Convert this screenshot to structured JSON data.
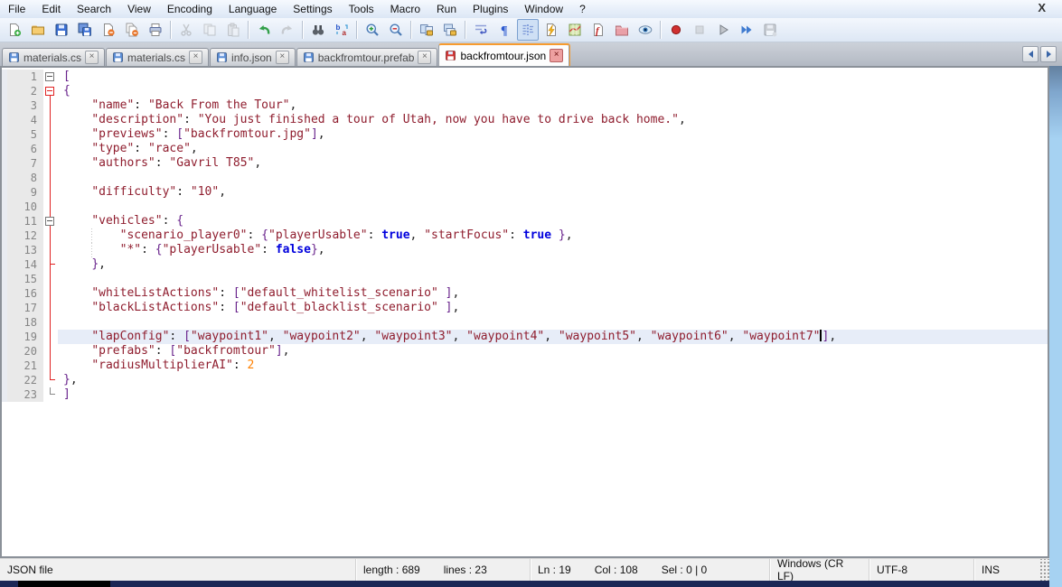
{
  "window": {
    "close_label": "X"
  },
  "palette": {
    "accent_tab_orange": "#f79b2e",
    "string_red": "#8f1d2e",
    "brace_purple": "#68228b",
    "bool_blue": "#0000dd",
    "number_orange": "#ff8000",
    "fold_active_red": "#e02222",
    "current_line_bg": "#e7edf8",
    "aero_border_blue": "#a6d2f2"
  },
  "menu": {
    "items": [
      "File",
      "Edit",
      "Search",
      "View",
      "Encoding",
      "Language",
      "Settings",
      "Tools",
      "Macro",
      "Run",
      "Plugins",
      "Window",
      "?"
    ]
  },
  "toolbar": {
    "items": [
      {
        "name": "new-file-icon"
      },
      {
        "name": "open-icon"
      },
      {
        "name": "save-icon"
      },
      {
        "name": "save-all-icon"
      },
      {
        "name": "close-icon"
      },
      {
        "name": "close-all-icon"
      },
      {
        "name": "print-icon"
      },
      {
        "sep": true
      },
      {
        "name": "cut-icon",
        "disabled": true
      },
      {
        "name": "copy-icon",
        "disabled": true
      },
      {
        "name": "paste-icon",
        "disabled": true
      },
      {
        "sep": true
      },
      {
        "name": "undo-icon"
      },
      {
        "name": "redo-icon",
        "disabled": true
      },
      {
        "sep": true
      },
      {
        "name": "find-icon"
      },
      {
        "name": "replace-icon"
      },
      {
        "sep": true
      },
      {
        "name": "zoom-in-icon"
      },
      {
        "name": "zoom-out-icon"
      },
      {
        "sep": true
      },
      {
        "name": "sync-vertical-icon"
      },
      {
        "name": "sync-horizontal-icon"
      },
      {
        "sep": true
      },
      {
        "name": "word-wrap-icon"
      },
      {
        "name": "show-all-characters-icon"
      },
      {
        "name": "show-indent-guide-icon",
        "pressed": true
      },
      {
        "name": "user-defined-dialog-icon"
      },
      {
        "name": "document-map-icon"
      },
      {
        "name": "function-list-icon"
      },
      {
        "name": "folder-as-workspace-icon"
      },
      {
        "name": "monitoring-icon"
      },
      {
        "sep": true
      },
      {
        "name": "record-macro-icon"
      },
      {
        "name": "stop-macro-icon",
        "disabled": true
      },
      {
        "name": "play-macro-icon"
      },
      {
        "name": "run-macro-multiple-icon"
      },
      {
        "name": "save-macro-icon",
        "disabled": true
      }
    ]
  },
  "tabs": {
    "items": [
      {
        "label": "materials.cs",
        "active": false,
        "modified": false
      },
      {
        "label": "materials.cs",
        "active": false,
        "modified": false
      },
      {
        "label": "info.json",
        "active": false,
        "modified": false
      },
      {
        "label": "backfromtour.prefab",
        "active": false,
        "modified": false
      },
      {
        "label": "backfromtour.json",
        "active": true,
        "modified": true
      }
    ]
  },
  "editor": {
    "current_line": 19,
    "lines": [
      {
        "n": 1,
        "fold": "box",
        "segs": [
          [
            "br",
            "["
          ]
        ]
      },
      {
        "n": 2,
        "fold": "boxr",
        "segs": [
          [
            "br",
            "{"
          ]
        ]
      },
      {
        "n": 3,
        "fold": "v",
        "segs": [
          [
            "d",
            "    "
          ],
          [
            "s",
            "\"name\""
          ],
          [
            "d",
            ": "
          ],
          [
            "s",
            "\"Back From the Tour\""
          ],
          [
            "d",
            ","
          ]
        ]
      },
      {
        "n": 4,
        "fold": "v",
        "segs": [
          [
            "d",
            "    "
          ],
          [
            "s",
            "\"description\""
          ],
          [
            "d",
            ": "
          ],
          [
            "s",
            "\"You just finished a tour of Utah, now you have to drive back home.\""
          ],
          [
            "d",
            ","
          ]
        ]
      },
      {
        "n": 5,
        "fold": "v",
        "segs": [
          [
            "d",
            "    "
          ],
          [
            "s",
            "\"previews\""
          ],
          [
            "d",
            ": "
          ],
          [
            "br",
            "["
          ],
          [
            "s",
            "\"backfromtour.jpg\""
          ],
          [
            "br",
            "]"
          ],
          [
            "d",
            ","
          ]
        ]
      },
      {
        "n": 6,
        "fold": "v",
        "segs": [
          [
            "d",
            "    "
          ],
          [
            "s",
            "\"type\""
          ],
          [
            "d",
            ": "
          ],
          [
            "s",
            "\"race\""
          ],
          [
            "d",
            ","
          ]
        ]
      },
      {
        "n": 7,
        "fold": "v",
        "segs": [
          [
            "d",
            "    "
          ],
          [
            "s",
            "\"authors\""
          ],
          [
            "d",
            ": "
          ],
          [
            "s",
            "\"Gavril T85\""
          ],
          [
            "d",
            ","
          ]
        ]
      },
      {
        "n": 8,
        "fold": "v",
        "segs": []
      },
      {
        "n": 9,
        "fold": "v",
        "segs": [
          [
            "d",
            "    "
          ],
          [
            "s",
            "\"difficulty\""
          ],
          [
            "d",
            ": "
          ],
          [
            "s",
            "\"10\""
          ],
          [
            "d",
            ","
          ]
        ]
      },
      {
        "n": 10,
        "fold": "v",
        "segs": []
      },
      {
        "n": 11,
        "fold": "vbox",
        "segs": [
          [
            "d",
            "    "
          ],
          [
            "s",
            "\"vehicles\""
          ],
          [
            "d",
            ": "
          ],
          [
            "br",
            "{"
          ]
        ]
      },
      {
        "n": 12,
        "fold": "v",
        "guide": true,
        "segs": [
          [
            "d",
            "        "
          ],
          [
            "s",
            "\"scenario_player0\""
          ],
          [
            "d",
            ": "
          ],
          [
            "br",
            "{"
          ],
          [
            "s",
            "\"playerUsable\""
          ],
          [
            "d",
            ": "
          ],
          [
            "b",
            "true"
          ],
          [
            "d",
            ", "
          ],
          [
            "s",
            "\"startFocus\""
          ],
          [
            "d",
            ": "
          ],
          [
            "b",
            "true"
          ],
          [
            "d",
            " "
          ],
          [
            "br",
            "}"
          ],
          [
            "d",
            ","
          ]
        ]
      },
      {
        "n": 13,
        "fold": "v",
        "guide": true,
        "segs": [
          [
            "d",
            "        "
          ],
          [
            "s",
            "\"*\""
          ],
          [
            "d",
            ": "
          ],
          [
            "br",
            "{"
          ],
          [
            "s",
            "\"playerUsable\""
          ],
          [
            "d",
            ": "
          ],
          [
            "b",
            "false"
          ],
          [
            "br",
            "}"
          ],
          [
            "d",
            ","
          ]
        ]
      },
      {
        "n": 14,
        "fold": "vtick",
        "segs": [
          [
            "d",
            "    "
          ],
          [
            "br",
            "}"
          ],
          [
            "d",
            ","
          ]
        ]
      },
      {
        "n": 15,
        "fold": "v",
        "segs": []
      },
      {
        "n": 16,
        "fold": "v",
        "segs": [
          [
            "d",
            "    "
          ],
          [
            "s",
            "\"whiteListActions\""
          ],
          [
            "d",
            ": "
          ],
          [
            "br",
            "["
          ],
          [
            "s",
            "\"default_whitelist_scenario\""
          ],
          [
            "d",
            " "
          ],
          [
            "br",
            "]"
          ],
          [
            "d",
            ","
          ]
        ]
      },
      {
        "n": 17,
        "fold": "v",
        "segs": [
          [
            "d",
            "    "
          ],
          [
            "s",
            "\"blackListActions\""
          ],
          [
            "d",
            ": "
          ],
          [
            "br",
            "["
          ],
          [
            "s",
            "\"default_blacklist_scenario\""
          ],
          [
            "d",
            " "
          ],
          [
            "br",
            "]"
          ],
          [
            "d",
            ","
          ]
        ]
      },
      {
        "n": 18,
        "fold": "v",
        "segs": []
      },
      {
        "n": 19,
        "fold": "v",
        "segs": [
          [
            "d",
            "    "
          ],
          [
            "s",
            "\"lapConfig\""
          ],
          [
            "d",
            ": "
          ],
          [
            "br",
            "["
          ],
          [
            "s",
            "\"waypoint1\""
          ],
          [
            "d",
            ", "
          ],
          [
            "s",
            "\"waypoint2\""
          ],
          [
            "d",
            ", "
          ],
          [
            "s",
            "\"waypoint3\""
          ],
          [
            "d",
            ", "
          ],
          [
            "s",
            "\"waypoint4\""
          ],
          [
            "d",
            ", "
          ],
          [
            "s",
            "\"waypoint5\""
          ],
          [
            "d",
            ", "
          ],
          [
            "s",
            "\"waypoint6\""
          ],
          [
            "d",
            ", "
          ],
          [
            "s",
            "\"waypoint7\""
          ],
          [
            "caret",
            ""
          ],
          [
            "br",
            "]"
          ],
          [
            "d",
            ","
          ]
        ]
      },
      {
        "n": 20,
        "fold": "v",
        "segs": [
          [
            "d",
            "    "
          ],
          [
            "s",
            "\"prefabs\""
          ],
          [
            "d",
            ": "
          ],
          [
            "br",
            "["
          ],
          [
            "s",
            "\"backfromtour\""
          ],
          [
            "br",
            "]"
          ],
          [
            "d",
            ","
          ]
        ]
      },
      {
        "n": 21,
        "fold": "v",
        "segs": [
          [
            "d",
            "    "
          ],
          [
            "s",
            "\"radiusMultiplierAI\""
          ],
          [
            "d",
            ": "
          ],
          [
            "n",
            "2"
          ]
        ]
      },
      {
        "n": 22,
        "fold": "corner",
        "segs": [
          [
            "br",
            "}"
          ],
          [
            "d",
            ","
          ]
        ]
      },
      {
        "n": 23,
        "fold": "cornerg",
        "segs": [
          [
            "br",
            "]"
          ]
        ]
      }
    ]
  },
  "status": {
    "doc_type": "JSON file",
    "length_label": "length : 689",
    "lines_label": "lines : 23",
    "ln_label": "Ln : 19",
    "col_label": "Col : 108",
    "sel_label": "Sel : 0 | 0",
    "eol_label": "Windows (CR LF)",
    "encoding_label": "UTF-8",
    "insert_mode_label": "INS"
  }
}
